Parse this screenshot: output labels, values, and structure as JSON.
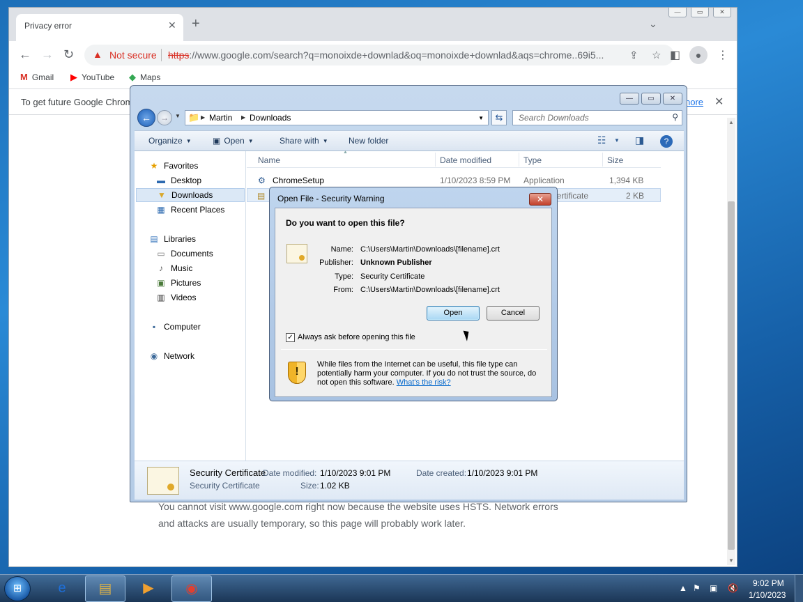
{
  "chrome": {
    "tab_title": "Privacy error",
    "tab_close": "✕",
    "new_tab": "+",
    "tab_search": "⌄",
    "win_minimize": "—",
    "win_restore": "▭",
    "win_close": "✕",
    "not_secure": "Not secure",
    "url_https": "https",
    "url_rest": "://www.google.com/search?q=monoixde+downlad&oq=monoixde+downlad&aqs=chrome..69i5...",
    "bookmarks": [
      "Gmail",
      "YouTube",
      "Maps"
    ],
    "infobar_text": "To get future Google Chrom",
    "infobar_more": "nore",
    "infobar_close": "✕",
    "page_text": "You cannot visit www.google.com right now because the website uses HSTS. Network errors and attacks are usually temporary, so this page will probably work later."
  },
  "explorer": {
    "win_minimize": "—",
    "win_maximize": "▭",
    "win_close": "✕",
    "breadcrumb": [
      "Martin",
      "Downloads"
    ],
    "search_placeholder": "Search Downloads",
    "commands": {
      "organize": "Organize",
      "open": "Open",
      "share_with": "Share with",
      "new_folder": "New folder"
    },
    "nav": {
      "favorites": "Favorites",
      "desktop": "Desktop",
      "downloads": "Downloads",
      "recent_places": "Recent Places",
      "libraries": "Libraries",
      "documents": "Documents",
      "music": "Music",
      "pictures": "Pictures",
      "videos": "Videos",
      "computer": "Computer",
      "network": "Network"
    },
    "columns": {
      "name": "Name",
      "date_modified": "Date modified",
      "type": "Type",
      "size": "Size"
    },
    "files": [
      {
        "name": "ChromeSetup",
        "date": "1/10/2023 8:59 PM",
        "type": "Application",
        "size": "1,394 KB"
      },
      {
        "name": "",
        "date": "",
        "type": "Certificate",
        "size": "2 KB"
      }
    ],
    "details": {
      "name": "Security Certificate",
      "type": "Security Certificate",
      "date_modified_label": "Date modified:",
      "date_modified": "1/10/2023 9:01 PM",
      "size_label": "Size:",
      "size": "1.02 KB",
      "date_created_label": "Date created:",
      "date_created": "1/10/2023 9:01 PM"
    }
  },
  "dialog": {
    "title": "Open File - Security Warning",
    "close": "✕",
    "question": "Do you want to open this file?",
    "labels": {
      "name": "Name:",
      "publisher": "Publisher:",
      "type": "Type:",
      "from": "From:"
    },
    "values": {
      "name": "C:\\Users\\Martin\\Downloads\\[filename].crt",
      "publisher": "Unknown Publisher",
      "type": "Security Certificate",
      "from": "C:\\Users\\Martin\\Downloads\\[filename].crt"
    },
    "open_button": "Open",
    "cancel_button": "Cancel",
    "checkbox_checked": true,
    "checkbox_label": "Always ask before opening this file",
    "warning_text": "While files from the Internet can be useful, this file type can potentially harm your computer. If you do not trust the source, do not open this software.",
    "warning_link": "What's the risk?"
  },
  "taskbar": {
    "time": "9:02 PM",
    "date": "1/10/2023"
  }
}
